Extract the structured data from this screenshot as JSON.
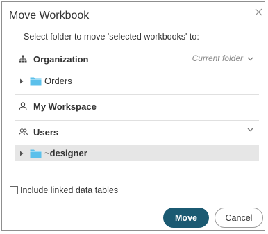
{
  "dialog": {
    "title": "Move Workbook",
    "close_icon": "close-icon",
    "subtitle": "Select folder to move 'selected workbooks' to:"
  },
  "sections": {
    "organization": {
      "label": "Organization",
      "icon": "org-tree-icon",
      "right_label": "Current folder",
      "children": [
        {
          "label": "Orders",
          "icon": "folder-icon"
        }
      ]
    },
    "workspace": {
      "label": "My Workspace",
      "icon": "user-icon"
    },
    "users": {
      "label": "Users",
      "icon": "users-icon",
      "children": [
        {
          "label": "~designer",
          "icon": "folder-icon",
          "selected": true
        }
      ]
    }
  },
  "options": {
    "include_linked_label": "Include linked data tables",
    "include_linked_checked": false
  },
  "buttons": {
    "move_label": "Move",
    "cancel_label": "Cancel"
  },
  "colors": {
    "primary": "#1b5a72",
    "folder": "#5bc0eb",
    "selected_row": "#e6e6e6"
  }
}
